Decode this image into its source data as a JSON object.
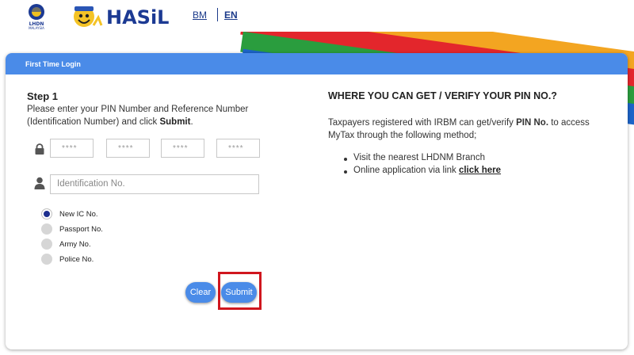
{
  "header": {
    "lang_bm": "BM",
    "lang_en": "EN",
    "logo_lhdn_text": "LHDN MALAYSIA",
    "logo_hasil_text": "HASiL"
  },
  "card": {
    "title": "First Time Login"
  },
  "step": {
    "title": "Step 1",
    "desc_prefix": "Please enter your PIN Number and Reference Number (Identification Number) and click ",
    "desc_bold": "Submit",
    "desc_suffix": "."
  },
  "pin_fields": [
    {
      "placeholder": "****"
    },
    {
      "placeholder": "****"
    },
    {
      "placeholder": "****"
    },
    {
      "placeholder": "****"
    }
  ],
  "id_field": {
    "placeholder": "Identification No."
  },
  "id_types": [
    {
      "label": "New IC No.",
      "checked": true
    },
    {
      "label": "Passport No.",
      "checked": false
    },
    {
      "label": "Army No.",
      "checked": false
    },
    {
      "label": "Police No.",
      "checked": false
    }
  ],
  "buttons": {
    "clear": "Clear",
    "submit": "Submit"
  },
  "info": {
    "title": "WHERE YOU CAN GET / VERIFY YOUR PIN NO.?",
    "desc_prefix": "Taxpayers registered with IRBM can get/verify ",
    "desc_bold": "PIN No.",
    "desc_suffix": " to access MyTax through the following method;",
    "items": [
      {
        "text": "Visit the nearest LHDNM Branch"
      },
      {
        "text": "Online application via link ",
        "link": "click here"
      }
    ]
  },
  "colors": {
    "accent": "#4a8be8",
    "highlight": "#d0161e",
    "radio_checked": "#1d2f8f"
  }
}
